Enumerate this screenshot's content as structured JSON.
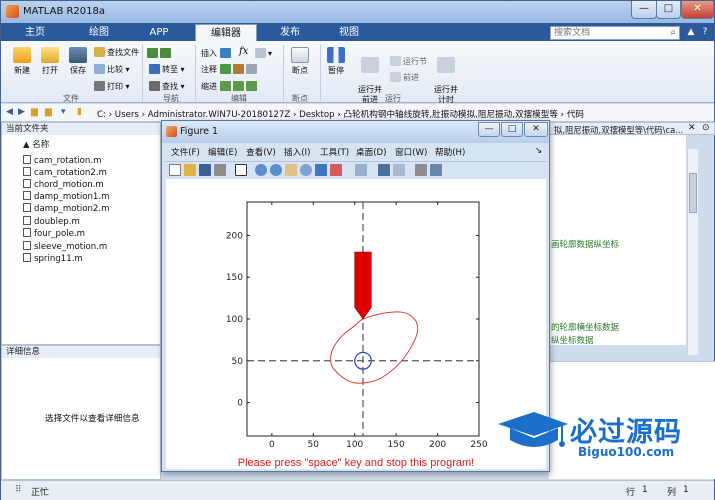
{
  "app": {
    "title": "MATLAB R2018a"
  },
  "window_controls": {
    "minimize": "—",
    "maximize": "□",
    "close": "✕"
  },
  "tabs": [
    "主页",
    "绘图",
    "APP",
    "编辑器",
    "发布",
    "视图"
  ],
  "search": {
    "placeholder": "搜索文档",
    "icon": "search-icon"
  },
  "ribbon": {
    "file": {
      "new": "新建",
      "open": "打开",
      "save": "保存",
      "find_files": "查找文件",
      "compare": "比较",
      "print": "打印",
      "label": "文件"
    },
    "navigate": {
      "goto": "转至",
      "find": "查找",
      "label": "导航"
    },
    "edit": {
      "insert": "插入",
      "comment": "注释",
      "indent": "缩进",
      "fx": "fx",
      "label": "编辑"
    },
    "breakpoints": {
      "breakpoints": "断点",
      "label": "断点"
    },
    "run": {
      "pause": "暂停",
      "run_advance": "运行并\n前进",
      "run_section": "运行节",
      "advance": "前进",
      "run_time": "运行并\n计时",
      "label": "运行"
    }
  },
  "address": {
    "path": "C: › Users › Administrator.WIN7U-20180127Z › Desktop › 凸轮机构钢中轴线旋转,肚振动模拟,阻尼振动,双摆模型等 › 代码"
  },
  "current_folder": {
    "title": "当前文件夹",
    "column": "名称",
    "files": [
      "cam_rotation.m",
      "cam_rotation2.m",
      "chord_motion.m",
      "damp_motion1.m",
      "damp_motion2.m",
      "doublep.m",
      "four_pole.m",
      "sleeve_motion.m",
      "spring11.m"
    ]
  },
  "details": {
    "title": "详细信息",
    "message": "选择文件以查看详细信息"
  },
  "editor": {
    "tab_path": "拟,阻尼振动,双摆模型等\\代码\\ca...",
    "lines": [
      "画轮廓数据纵坐标",
      "的轮廓横坐标数据",
      "纵坐标数据"
    ]
  },
  "status": {
    "left": "正忙",
    "row_label": "行",
    "row": "1",
    "col_label": "列",
    "col": "1"
  },
  "figure": {
    "title": "Figure 1",
    "menus": [
      "文件(F)",
      "编辑(E)",
      "查看(V)",
      "插入(I)",
      "工具(T)",
      "桌面(D)",
      "窗口(W)",
      "帮助(H)"
    ],
    "prompt": "Please press \"space\" key and stop this program!"
  },
  "chart_data": {
    "type": "line",
    "xlim": [
      -30,
      250
    ],
    "ylim": [
      -40,
      240
    ],
    "xticks": [
      0,
      50,
      100,
      150,
      200,
      250
    ],
    "yticks": [
      0,
      50,
      100,
      150,
      200
    ],
    "grid": false,
    "colors": {
      "cam": "#e03a3a",
      "follower": "#e00000",
      "circle": "#1f3fbf",
      "axis_lines": "#555555"
    },
    "cam_center": [
      110,
      50
    ],
    "base_circle_radius": 10,
    "follower_tip": [
      110,
      100
    ],
    "follower_top": 180,
    "cam_profile": [
      [
        110,
        100
      ],
      [
        135,
        107
      ],
      [
        158,
        108
      ],
      [
        172,
        100
      ],
      [
        176,
        87
      ],
      [
        170,
        70
      ],
      [
        155,
        48
      ],
      [
        133,
        30
      ],
      [
        115,
        24
      ],
      [
        98,
        24
      ],
      [
        83,
        32
      ],
      [
        72,
        45
      ],
      [
        73,
        63
      ],
      [
        85,
        80
      ],
      [
        100,
        92
      ],
      [
        110,
        100
      ]
    ]
  },
  "watermark": {
    "cn": "必过源码",
    "en": "Biguo100.com"
  }
}
